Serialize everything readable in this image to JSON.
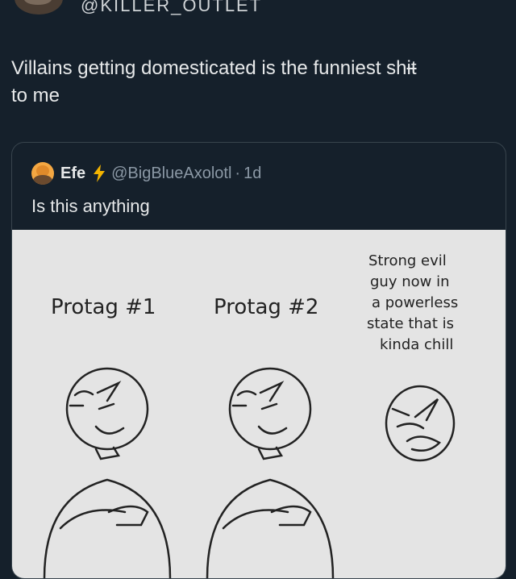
{
  "header": {
    "handle": "@KILLER_OUTLET"
  },
  "tweet": {
    "text": "Villains getting domesticated is the funniest shit to me",
    "line1": "Villains getting domesticated is the funniest sh",
    "censored": "i",
    "censored_tail": "t",
    "line2": "to me"
  },
  "quote": {
    "name": "Efe",
    "handle": "@BigBlueAxolotl",
    "separator": "·",
    "time": "1d",
    "text": "Is this anything",
    "icons": {
      "avatar": "avatar",
      "badge": "lightning-bolt-icon"
    },
    "badge_color": "#f4b400"
  },
  "comic": {
    "label_1": "Protag #1",
    "label_2": "Protag #2",
    "caption_lines": [
      "Strong evil",
      "guy now in",
      "a powerless",
      "state that is",
      "kinda chill"
    ]
  }
}
